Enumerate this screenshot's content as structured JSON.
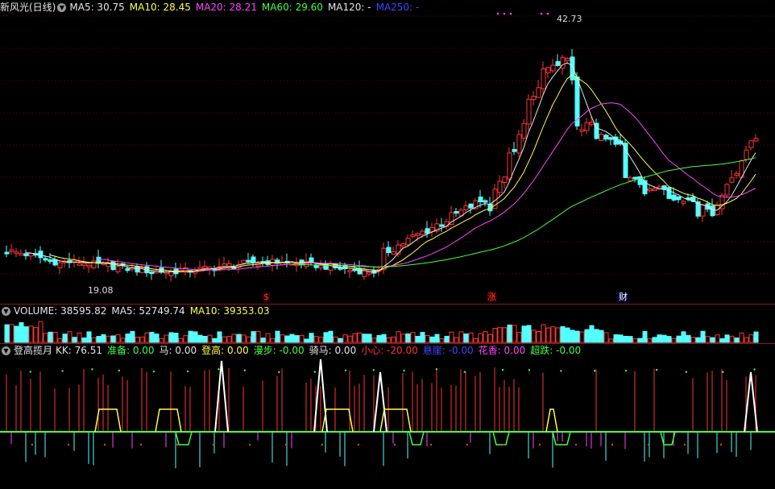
{
  "price_panel": {
    "stock_name": "新风光(日线)",
    "ma": [
      {
        "label": "MA5: 30.75",
        "color": "#e6e6e6"
      },
      {
        "label": "MA10: 28.45",
        "color": "#ffff44"
      },
      {
        "label": "MA20: 28.21",
        "color": "#ff44ff"
      },
      {
        "label": "MA60: 29.60",
        "color": "#44ff44"
      },
      {
        "label": "MA120: -",
        "color": "#e6e6e6"
      },
      {
        "label": "MA250: -",
        "color": "#4444ff"
      }
    ],
    "high_label": "42.73",
    "low_label": "19.08",
    "markers": [
      {
        "text": "$",
        "color": "#ff3333"
      },
      {
        "text": "涨",
        "color": "#ff3333"
      },
      {
        "text": "财",
        "color": "#ffffff"
      }
    ]
  },
  "volume_panel": {
    "items": [
      {
        "label": "VOLUME: 38595.82",
        "color": "#e6e6e6"
      },
      {
        "label": "MA5: 52749.74",
        "color": "#e6e6e6"
      },
      {
        "label": "MA10: 39353.03",
        "color": "#ffff44"
      }
    ]
  },
  "indicator_panel": {
    "name": "登高揽月",
    "items": [
      {
        "label": "KK: 76.51",
        "color": "#e6e6e6"
      },
      {
        "label": "准备: 0.00",
        "color": "#44ff44"
      },
      {
        "label": "马: 0.00",
        "color": "#e6e6e6"
      },
      {
        "label": "登高: 0.00",
        "color": "#ffff44"
      },
      {
        "label": "漫步: -0.00",
        "color": "#44ff44"
      },
      {
        "label": "骑马: 0.00",
        "color": "#e6e6e6"
      },
      {
        "label": "小心: -20.00",
        "color": "#ff3333"
      },
      {
        "label": "悬崖: -0.00",
        "color": "#4444ff"
      },
      {
        "label": "花香: 0.00",
        "color": "#ff44ff"
      },
      {
        "label": "超跌: -0.00",
        "color": "#44ff44"
      }
    ]
  },
  "colors": {
    "up": "#ff3333",
    "down": "#54ffff",
    "separator": "#8b1a1a"
  }
}
